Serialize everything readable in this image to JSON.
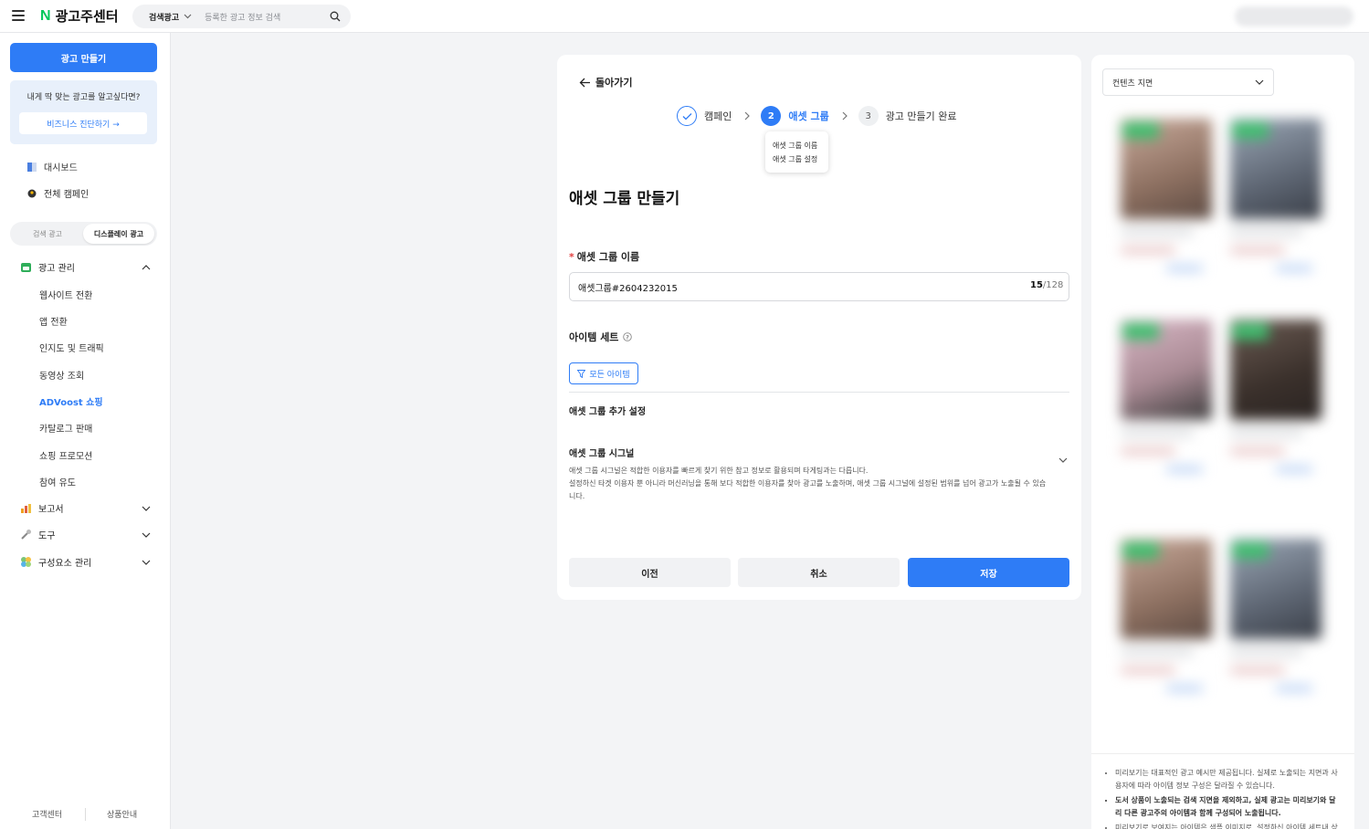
{
  "header": {
    "logo_n": "N",
    "logo_text": "광고주센터",
    "search_type": "검색광고",
    "search_placeholder": "등록한 광고 정보 검색"
  },
  "sidebar": {
    "make_ad": "광고 만들기",
    "promo_text": "내게 딱 맞는 광고를 알고싶다면?",
    "promo_button": "비즈니스 진단하기 →",
    "links": [
      "대시보드",
      "전체 캠페인"
    ],
    "segment": [
      "검색 광고",
      "디스플레이 광고"
    ],
    "ad_manage": "광고 관리",
    "sub_items": [
      "웹사이트 전환",
      "앱 전환",
      "인지도 및 트래픽",
      "동영상 조회",
      "ADVoost 쇼핑",
      "카탈로그 판매",
      "쇼핑 프로모션",
      "참여 유도"
    ],
    "groups": [
      "보고서",
      "도구",
      "구성요소 관리"
    ],
    "footer": [
      "고객센터",
      "상품안내"
    ]
  },
  "main": {
    "back": "돌아가기",
    "steps": [
      {
        "num": "",
        "label": "캠페인"
      },
      {
        "num": "2",
        "label": "애셋 그룹"
      },
      {
        "num": "3",
        "label": "광고 만들기 완료"
      }
    ],
    "tooltip": [
      "애셋 그룹 이름",
      "애셋 그룹 설정"
    ],
    "title": "애셋 그룹 만들기",
    "name_label": "애셋 그룹 이름",
    "name_value": "애셋그룹#2604232015",
    "counter_current": "15",
    "counter_max": "/128",
    "item_set_label": "아이템 세트",
    "filter_button": "모든 아이템",
    "extra_settings": "애셋 그룹 추가 설정",
    "signal_title": "애셋 그룹 시그널",
    "signal_desc_1": "애셋 그룹 시그널은 적합한 이용자를 빠르게 찾기 위한 참고 정보로 활용되며 타게팅과는 다릅니다.",
    "signal_desc_2": "설정하신 타겟 이용자 뿐 아니라 머신러닝을 통해 보다 적합한 이용자를 찾아 광고를 노출하며, 애셋 그룹 시그널에 설정된 범위를 넘어 광고가 노출될 수 있습니다.",
    "btn_prev": "이전",
    "btn_cancel": "취소",
    "btn_save": "저장"
  },
  "preview": {
    "select": "컨텐츠 지면",
    "notes": [
      "미리보기는 대표적인 광고 예시만 제공됩니다. 실제로 노출되는 지면과 사용자에 따라 아이템 정보 구성은 달라질 수 있습니다.",
      "도서 상품이 노출되는 검색 지면을 제외하고, 실제 광고는 미리보기와 달리 다른 광고주의 아이템과 함께 구성되어 노출됩니다.",
      "미리보기로 보여지는 아이템은 샘플 이미지로, 설정하신 아이템 세트내 상"
    ]
  },
  "colors": {
    "accent": "#2e7cf6",
    "naver_green": "#03c75a",
    "required": "#e23d3d"
  }
}
